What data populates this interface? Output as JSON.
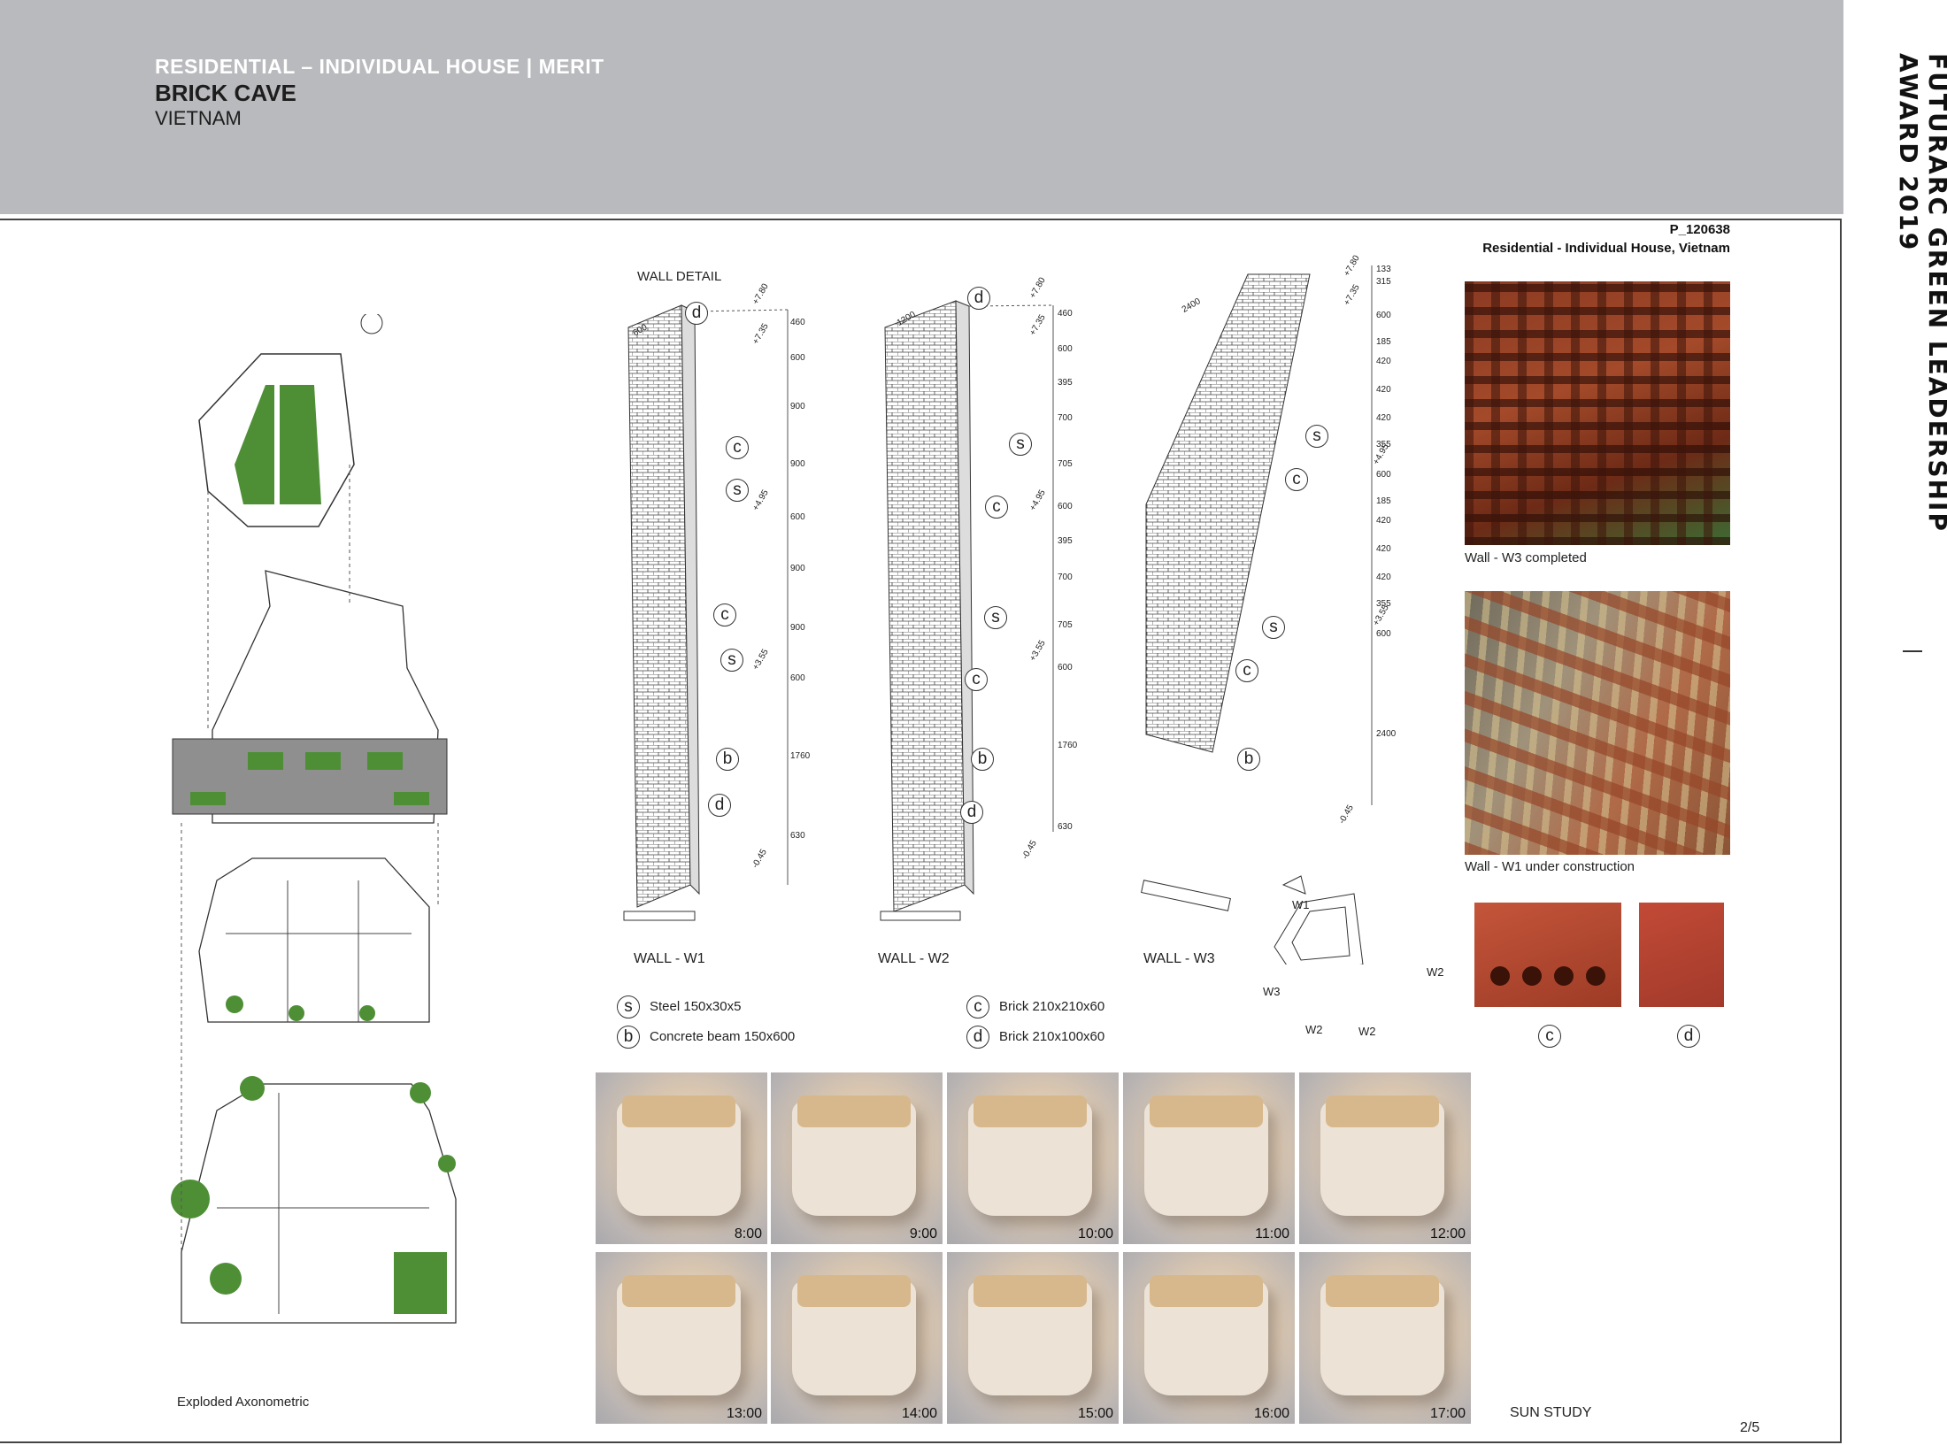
{
  "header": {
    "category": "RESIDENTIAL – INDIVIDUAL HOUSE",
    "separator": "|",
    "merit": "MERIT",
    "title": "BRICK CAVE",
    "country": "VIETNAM"
  },
  "award_title": "FUTURARC GREEN LEADERSHIP AWARD 2019",
  "project": {
    "id": "P_120638",
    "category": "Residential - Individual House, Vietnam"
  },
  "left_panel": {
    "caption": "Exploded Axonometric"
  },
  "wall_detail": {
    "title": "WALL DETAIL",
    "walls": [
      {
        "label": "WALL - W1",
        "width_dim": "600",
        "dims": [
          "460",
          "600",
          "900",
          "900",
          "600",
          "900",
          "900",
          "600",
          "1760",
          "630"
        ],
        "levels": [
          "+7.80",
          "+7.35",
          "+4.95",
          "+3.55",
          "-0.45"
        ]
      },
      {
        "label": "WALL - W2",
        "width_dim": "1200",
        "dims": [
          "460",
          "600",
          "395",
          "700",
          "705",
          "600",
          "395",
          "700",
          "705",
          "600",
          "1760",
          "630"
        ],
        "levels": [
          "+7.80",
          "+7.35",
          "+4.95",
          "+3.55",
          "-0.45"
        ]
      },
      {
        "label": "WALL - W3",
        "width_dim": "2400",
        "dims": [
          "133",
          "315",
          "600",
          "185",
          "420",
          "420",
          "420",
          "355",
          "600",
          "185",
          "420",
          "420",
          "420",
          "355",
          "600",
          "2400"
        ],
        "levels": [
          "+7.80",
          "+7.35",
          "+4.95",
          "+3.55",
          "-0.45"
        ]
      }
    ],
    "circle_labels": {
      "d": "d",
      "c": "c",
      "s": "s",
      "b": "b"
    },
    "plan_tags": [
      "W1",
      "W2",
      "W3",
      "W2",
      "W2"
    ],
    "legend": [
      {
        "key": "s",
        "text": "Steel 150x30x5"
      },
      {
        "key": "b",
        "text": "Concrete beam 150x600"
      },
      {
        "key": "c",
        "text": "Brick 210x210x60"
      },
      {
        "key": "d",
        "text": "Brick 210x100x60"
      }
    ]
  },
  "photos": {
    "w3_caption": "Wall - W3 completed",
    "w1_caption": "Wall - W1 under construction",
    "brick_labels": [
      "c",
      "d"
    ]
  },
  "sun_study": {
    "label": "SUN STUDY",
    "times": [
      "8:00",
      "9:00",
      "10:00",
      "11:00",
      "12:00",
      "13:00",
      "14:00",
      "15:00",
      "16:00",
      "17:00"
    ]
  },
  "page_number": "2/5",
  "colors": {
    "header_bg": "#b9babd",
    "brick": "#a8442a",
    "greenery": "#4e8f36"
  }
}
